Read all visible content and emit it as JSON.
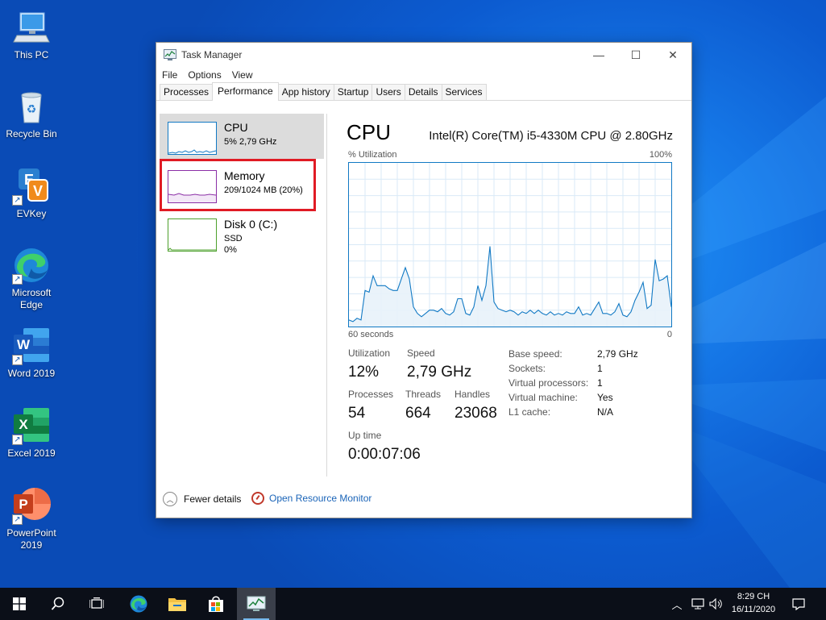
{
  "desktop": {
    "icons": [
      {
        "label": "This PC",
        "icon": "this-pc-icon"
      },
      {
        "label": "Recycle Bin",
        "icon": "recycle-bin-icon"
      },
      {
        "label": "EVKey",
        "icon": "evkey-icon"
      },
      {
        "label": "Microsoft Edge",
        "icon": "edge-icon"
      },
      {
        "label": "Word 2019",
        "icon": "word-icon"
      },
      {
        "label": "Excel 2019",
        "icon": "excel-icon"
      },
      {
        "label": "PowerPoint 2019",
        "icon": "powerpoint-icon"
      }
    ]
  },
  "window": {
    "title": "Task Manager",
    "menu": [
      "File",
      "Options",
      "View"
    ],
    "tabs": [
      "Processes",
      "Performance",
      "App history",
      "Startup",
      "Users",
      "Details",
      "Services"
    ],
    "active_tab": "Performance"
  },
  "left_pane": {
    "items": [
      {
        "name": "CPU",
        "line1": "5%  2,79 GHz",
        "line2": "",
        "color": "#1179c4"
      },
      {
        "name": "Memory",
        "line1": "209/1024 MB (20%)",
        "line2": "",
        "color": "#8b2fa6"
      },
      {
        "name": "Disk 0 (C:)",
        "line1": "SSD",
        "line2": "0%",
        "color": "#4da02c"
      }
    ]
  },
  "main": {
    "title": "CPU",
    "processor": "Intel(R) Core(TM) i5-4330M CPU @ 2.80GHz",
    "util_label": "% Utilization",
    "util_max": "100%",
    "time_label": "60 seconds",
    "time_end": "0",
    "utilization_series": [
      4,
      3,
      5,
      4,
      22,
      21,
      31,
      25,
      25,
      25,
      23,
      22,
      22,
      29,
      36,
      29,
      12,
      8,
      6,
      8,
      10,
      10,
      9,
      11,
      8,
      7,
      9,
      17,
      17,
      8,
      7,
      12,
      25,
      16,
      25,
      49,
      15,
      11,
      10,
      9,
      10,
      9,
      7,
      9,
      8,
      10,
      8,
      10,
      8,
      7,
      9,
      7,
      8,
      7,
      9,
      8,
      8,
      12,
      7,
      8,
      7,
      11,
      15,
      8,
      8,
      7,
      9,
      14,
      7,
      6,
      9,
      16,
      21,
      27,
      11,
      13,
      41,
      28,
      29,
      31,
      12
    ],
    "stats": {
      "utilization_label": "Utilization",
      "utilization": "12%",
      "speed_label": "Speed",
      "speed": "2,79 GHz",
      "processes_label": "Processes",
      "processes": "54",
      "threads_label": "Threads",
      "threads": "664",
      "handles_label": "Handles",
      "handles": "23068",
      "uptime_label": "Up time",
      "uptime": "0:00:07:06"
    },
    "details": [
      {
        "k": "Base speed:",
        "v": "2,79 GHz"
      },
      {
        "k": "Sockets:",
        "v": "1"
      },
      {
        "k": "Virtual processors:",
        "v": "1"
      },
      {
        "k": "Virtual machine:",
        "v": "Yes"
      },
      {
        "k": "L1 cache:",
        "v": "N/A"
      }
    ]
  },
  "footer": {
    "fewer_details": "Fewer details",
    "open_resmon": "Open Resource Monitor"
  },
  "taskbar": {
    "time": "8:29 CH",
    "date": "16/11/2020"
  },
  "colors": {
    "cpu": "#1179c4",
    "memory": "#8b2fa6",
    "disk": "#4da02c",
    "highlight": "#e01b24"
  }
}
